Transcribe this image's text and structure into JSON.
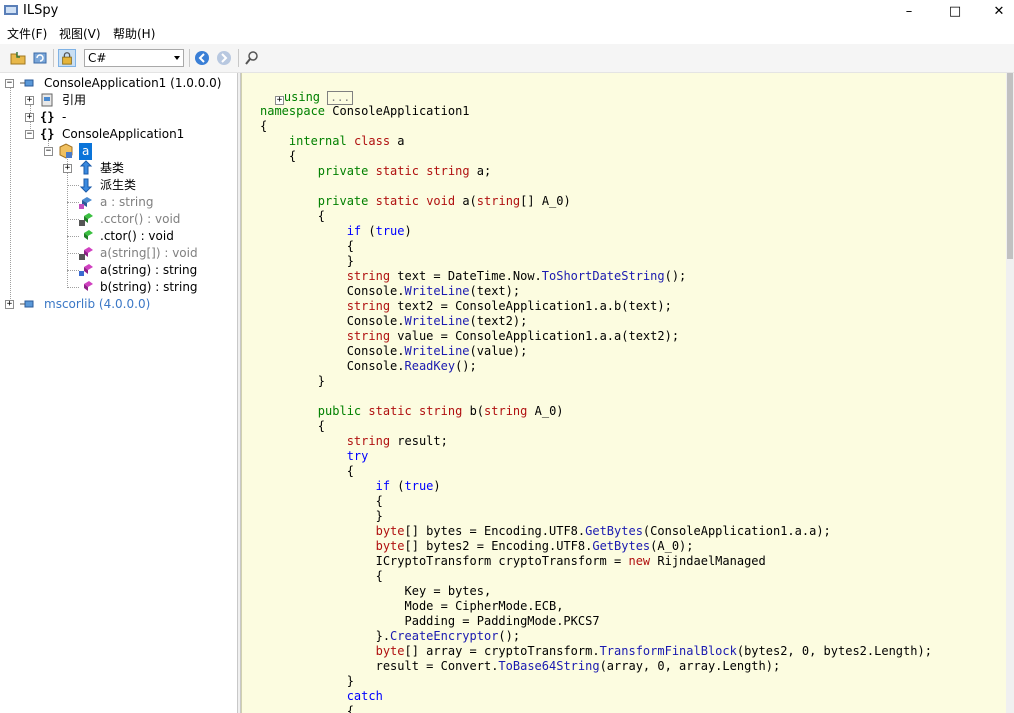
{
  "window": {
    "title": "ILSpy",
    "minimize": "–",
    "maximize": "□",
    "close": "✕"
  },
  "menu": {
    "file": "文件(F)",
    "view": "视图(V)",
    "help": "帮助(H)"
  },
  "toolbar": {
    "language": "C#"
  },
  "tree": {
    "assembly1": "ConsoleApplication1 (1.0.0.0)",
    "references": "引用",
    "ns_empty_braces": "{}",
    "ns_empty": "-",
    "ns_braces": "{}",
    "ns_name": "ConsoleApplication1",
    "class_a": "a",
    "base_types": "基类",
    "derived_types": "派生类",
    "field_a": "a : string",
    "cctor": ".cctor() : void",
    "ctor": ".ctor() : void",
    "method_a_arr": "a(string[]) : void",
    "method_a_str": "a(string) : string",
    "method_b_str": "b(string) : string",
    "assembly2": "mscorlib (4.0.0.0)"
  },
  "code": {
    "using_kw": "using",
    "using_box": "...",
    "lines": [
      "namespace ConsoleApplication1",
      "{",
      "    internal class a",
      "    {",
      "        private static string a;",
      "",
      "        private static void a(string[] A_0)",
      "        {",
      "            if (true)",
      "            {",
      "            }",
      "            string text = DateTime.Now.ToShortDateString();",
      "            Console.WriteLine(text);",
      "            string text2 = ConsoleApplication1.a.b(text);",
      "            Console.WriteLine(text2);",
      "            string value = ConsoleApplication1.a.a(text2);",
      "            Console.WriteLine(value);",
      "            Console.ReadKey();",
      "        }",
      "",
      "        public static string b(string A_0)",
      "        {",
      "            string result;",
      "            try",
      "            {",
      "                if (true)",
      "                {",
      "                }",
      "                byte[] bytes = Encoding.UTF8.GetBytes(ConsoleApplication1.a.a);",
      "                byte[] bytes2 = Encoding.UTF8.GetBytes(A_0);",
      "                ICryptoTransform cryptoTransform = new RijndaelManaged",
      "                {",
      "                    Key = bytes,",
      "                    Mode = CipherMode.ECB,",
      "                    Padding = PaddingMode.PKCS7",
      "                }.CreateEncryptor();",
      "                byte[] array = cryptoTransform.TransformFinalBlock(bytes2, 0, bytes2.Length);",
      "                result = Convert.ToBase64String(array, 0, array.Length);",
      "            }",
      "            catch",
      "            {"
    ]
  }
}
